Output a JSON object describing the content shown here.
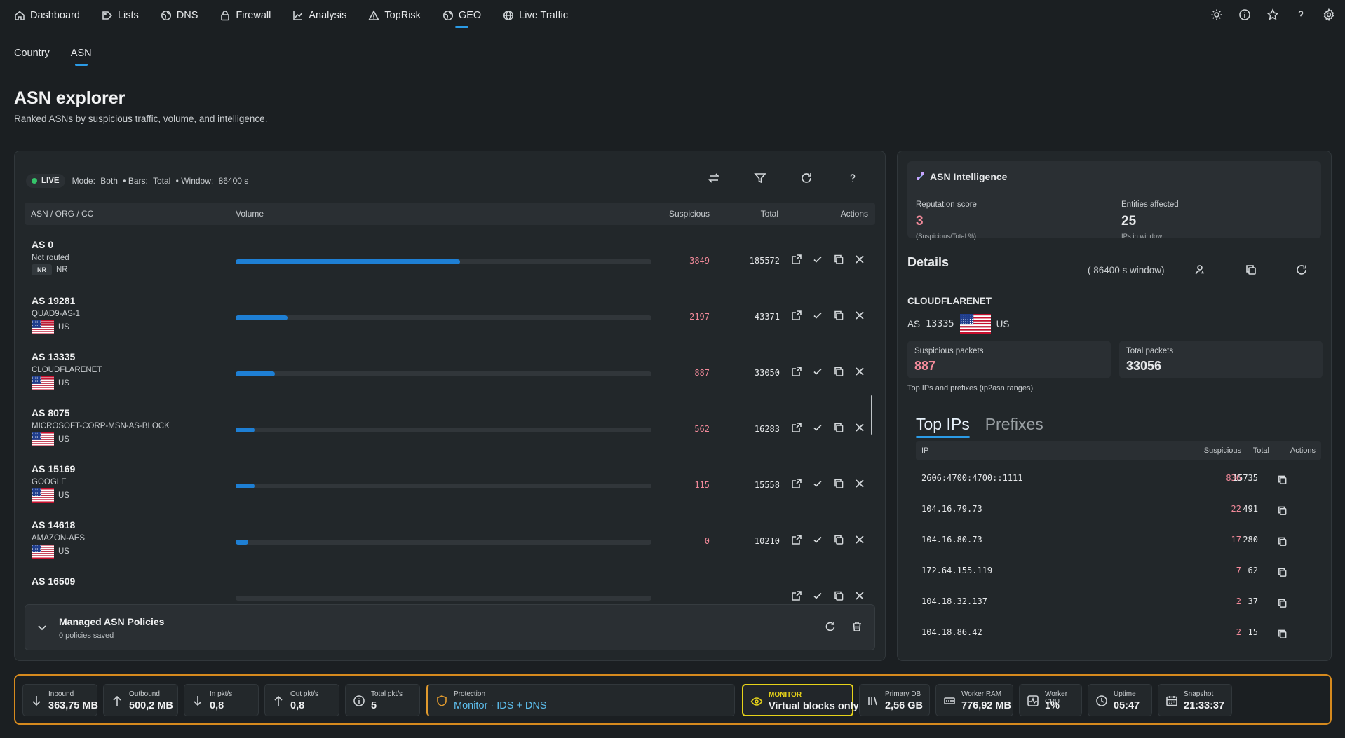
{
  "nav": {
    "items": [
      {
        "label": "Dashboard",
        "icon": "home-icon"
      },
      {
        "label": "Lists",
        "icon": "tag-icon"
      },
      {
        "label": "DNS",
        "icon": "globe-icon"
      },
      {
        "label": "Firewall",
        "icon": "lock-icon"
      },
      {
        "label": "Analysis",
        "icon": "chart-icon"
      },
      {
        "label": "TopRisk",
        "icon": "warning-icon"
      },
      {
        "label": "GEO",
        "icon": "globe-icon",
        "active": true
      },
      {
        "label": "Live Traffic",
        "icon": "globe-grid-icon"
      }
    ],
    "right_icons": [
      "sun-icon",
      "info-icon",
      "star-icon",
      "help-icon",
      "settings-icon"
    ]
  },
  "subtabs": [
    {
      "label": "Country"
    },
    {
      "label": "ASN",
      "active": true
    }
  ],
  "page": {
    "title": "ASN explorer",
    "subtitle": "Ranked ASNs by suspicious traffic, volume, and intelligence."
  },
  "toolbar": {
    "live": "LIVE",
    "mode_label": "Mode:",
    "mode_value": "Both",
    "bars_label": "• Bars:",
    "bars_value": "Total",
    "window_label": "• Window:",
    "window_value": "86400 s"
  },
  "table": {
    "headers": {
      "asn": "ASN / ORG / CC",
      "volume": "Volume",
      "suspicious": "Suspicious",
      "total": "Total",
      "actions": "Actions"
    },
    "rows": [
      {
        "asn": "AS 0",
        "org": "Not routed",
        "cc": "NR",
        "badge": "NR",
        "suspicious": "3849",
        "total": "185572",
        "share": 0.54
      },
      {
        "asn": "AS 19281",
        "org": "QUAD9-AS-1",
        "cc": "US",
        "suspicious": "2197",
        "total": "43371",
        "share": 0.125
      },
      {
        "asn": "AS 13335",
        "org": "CLOUDFLARENET",
        "cc": "US",
        "suspicious": "887",
        "total": "33050",
        "share": 0.095
      },
      {
        "asn": "AS 8075",
        "org": "MICROSOFT-CORP-MSN-AS-BLOCK",
        "cc": "US",
        "suspicious": "562",
        "total": "16283",
        "share": 0.045
      },
      {
        "asn": "AS 15169",
        "org": "GOOGLE",
        "cc": "US",
        "suspicious": "115",
        "total": "15558",
        "share": 0.045
      },
      {
        "asn": "AS 14618",
        "org": "AMAZON-AES",
        "cc": "US",
        "suspicious": "0",
        "total": "10210",
        "share": 0.03
      },
      {
        "asn": "AS 16509",
        "org": "",
        "cc": "",
        "suspicious": "",
        "total": "",
        "share": 0
      }
    ]
  },
  "policies": {
    "title": "Managed ASN Policies",
    "subtitle": "0 policies saved"
  },
  "intel": {
    "title": "ASN Intelligence",
    "reputation_label": "Reputation score",
    "reputation_value": "3",
    "reputation_hint": "(Suspicious/Total %)",
    "entities_label": "Entities affected",
    "entities_value": "25",
    "entities_hint": "IPs in window"
  },
  "details": {
    "title": "Details",
    "window": "( 86400 s window)",
    "org": "CLOUDFLARENET",
    "asn_prefix": "AS",
    "asn_number": "13335",
    "cc": "US",
    "suspicious_label": "Suspicious packets",
    "suspicious_value": "887",
    "total_label": "Total packets",
    "total_value": "33056",
    "top_label": "Top IPs and prefixes (ip2asn ranges)"
  },
  "ip_tabs": [
    {
      "label": "Top IPs",
      "active": true
    },
    {
      "label": "Prefixes"
    }
  ],
  "ip_table": {
    "headers": {
      "ip": "IP",
      "suspicious": "Suspicious",
      "total": "Total",
      "actions": "Actions"
    },
    "rows": [
      {
        "ip": "2606:4700:4700::1111",
        "suspicious": "836",
        "total": "15735"
      },
      {
        "ip": "104.16.79.73",
        "suspicious": "22",
        "total": "491"
      },
      {
        "ip": "104.16.80.73",
        "suspicious": "17",
        "total": "280"
      },
      {
        "ip": "172.64.155.119",
        "suspicious": "7",
        "total": "62"
      },
      {
        "ip": "104.18.32.137",
        "suspicious": "2",
        "total": "37"
      },
      {
        "ip": "104.18.86.42",
        "suspicious": "2",
        "total": "15"
      }
    ]
  },
  "status": {
    "inbound": {
      "label": "Inbound",
      "value": "363,75 MB"
    },
    "outbound": {
      "label": "Outbound",
      "value": "500,2 MB"
    },
    "in_pkt": {
      "label": "In pkt/s",
      "value": "0,8"
    },
    "out_pkt": {
      "label": "Out pkt/s",
      "value": "0,8"
    },
    "total_pkt": {
      "label": "Total pkt/s",
      "value": "5"
    },
    "protection": {
      "label": "Protection",
      "value": "Monitor · IDS + DNS"
    },
    "monitor": {
      "label": "MONITOR",
      "value": "Virtual blocks only"
    },
    "primary_db": {
      "label": "Primary DB",
      "value": "2,56 GB"
    },
    "worker_ram": {
      "label": "Worker RAM",
      "value": "776,92 MB"
    },
    "worker_cpu": {
      "label": "Worker CPU",
      "value": "1%"
    },
    "uptime": {
      "label": "Uptime",
      "value": "05:47"
    },
    "snapshot": {
      "label": "Snapshot",
      "value": "21:33:37"
    }
  },
  "colors": {
    "accent": "#2b9be6",
    "bar": "#1e7fd4",
    "suspicious": "#f28a9a",
    "warning_border": "#d68a1e",
    "monitor_border": "#e6d21a",
    "live": "#35c46a"
  }
}
